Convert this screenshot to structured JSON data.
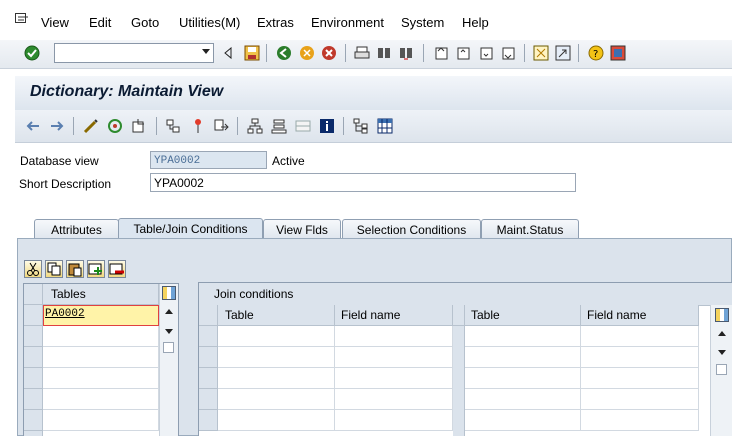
{
  "menu": [
    "View",
    "Edit",
    "Goto",
    "Utilities(M)",
    "Extras",
    "Environment",
    "System",
    "Help"
  ],
  "title": "Dictionary: Maintain View",
  "form": {
    "database_view_label": "Database view",
    "database_view_value": "YPA0002",
    "status": "Active",
    "short_description_label": "Short Description",
    "short_description_value": "YPA0002"
  },
  "tabs": [
    "Attributes",
    "Table/Join Conditions",
    "View Flds",
    "Selection Conditions",
    "Maint.Status"
  ],
  "active_tab": "Table/Join Conditions",
  "tables_grid": {
    "header": "Tables",
    "rows": [
      "PA0002"
    ]
  },
  "join_grid": {
    "title": "Join conditions",
    "columns": [
      "Table",
      "Field name",
      "Table",
      "Field name"
    ]
  },
  "colors": {
    "accent": "#dbe3ec",
    "highlight": "#fff3a8",
    "title": "#0b1b33"
  }
}
